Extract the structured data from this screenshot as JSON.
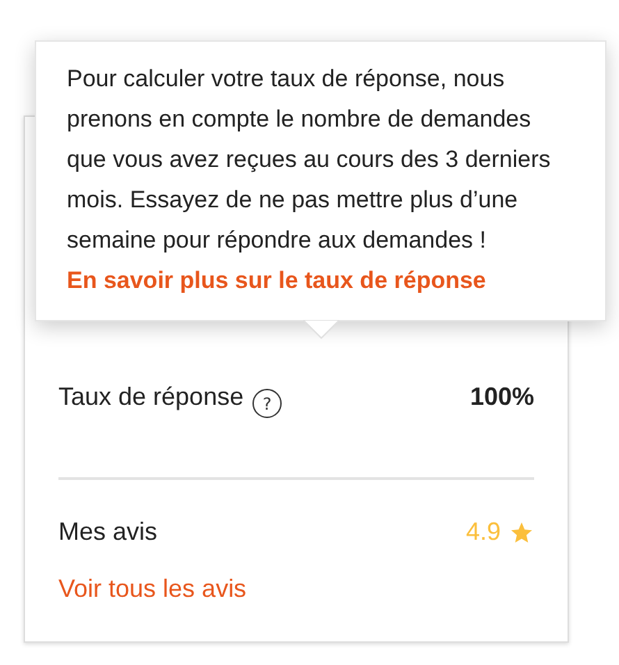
{
  "tooltip": {
    "text": "Pour calculer votre taux de réponse, nous prenons en compte le nombre de demandes que vous avez reçues au cours des 3 derniers mois. Essayez de ne pas mettre plus d’une semaine pour répondre aux demandes !",
    "link": "En savoir plus sur le taux de réponse"
  },
  "stats": [
    {
      "label": "Taux de réponse",
      "value": "100%",
      "kind": "rate",
      "help": "?"
    },
    {
      "label": "Mes avis",
      "value": "4.9",
      "kind": "rating",
      "link": "Voir tous les avis"
    }
  ]
}
